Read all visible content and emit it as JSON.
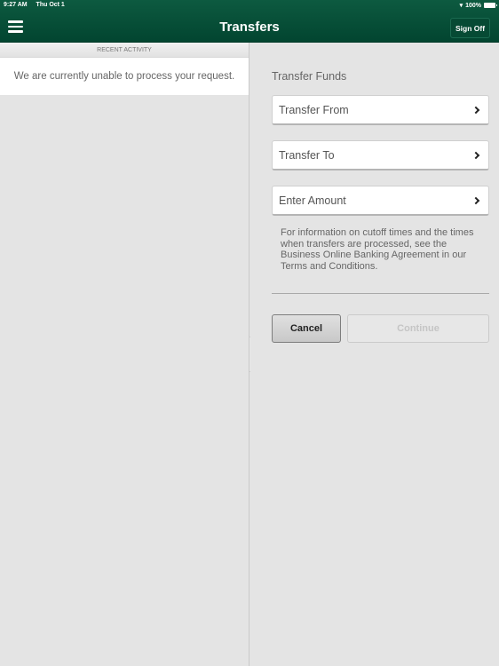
{
  "status_bar": {
    "time": "9:27 AM",
    "date": "Thu Oct 1",
    "battery": "100%"
  },
  "header": {
    "title": "Transfers",
    "sign_off": "Sign Off"
  },
  "left_pane": {
    "section_header": "RECENT ACTIVITY",
    "message": "We are currently unable to process your request."
  },
  "right_pane": {
    "title": "Transfer Funds",
    "fields": [
      {
        "label": "Transfer From"
      },
      {
        "label": "Transfer To"
      },
      {
        "label": "Enter Amount"
      }
    ],
    "info": "For information on cutoff times and the times when transfers are processed, see the Business Online Banking Agreement in our Terms and Conditions.",
    "cancel": "Cancel",
    "continue": "Continue"
  },
  "colors": {
    "header": "#024530",
    "background": "#e4e4e4"
  }
}
